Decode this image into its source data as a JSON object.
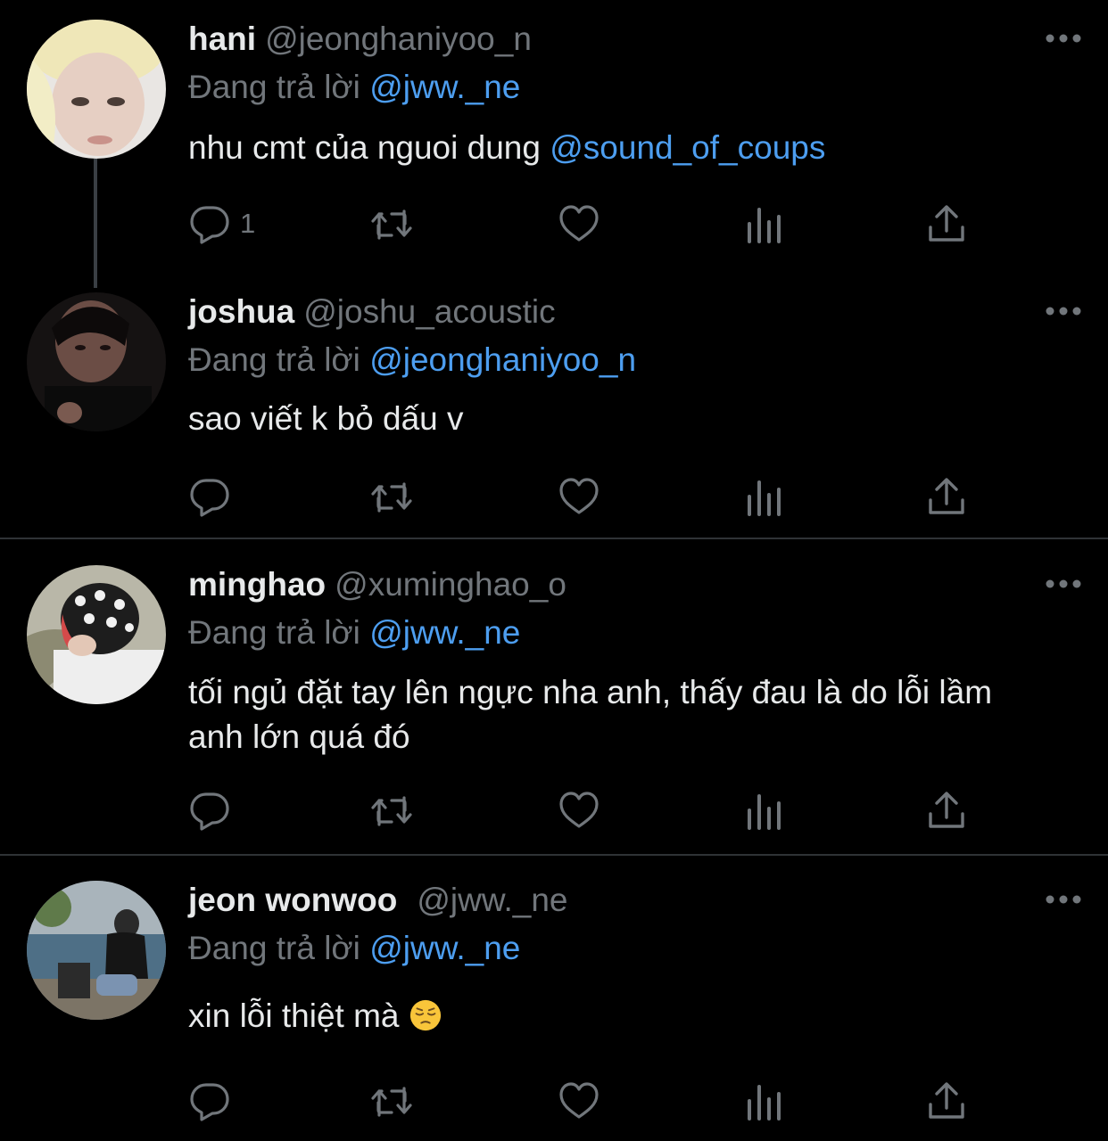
{
  "tweets": [
    {
      "name": "hani",
      "handle": "@jeonghaniyoo_n",
      "replying_prefix": "Đang trả lời",
      "replying_to": "@jww._ne",
      "text": "nhu cmt của nguoi dung ",
      "text_mention": "@sound_of_coups",
      "reply_count": "1"
    },
    {
      "name": "joshua",
      "handle": "@joshu_acoustic",
      "replying_prefix": "Đang trả lời",
      "replying_to": "@jeonghaniyoo_n",
      "text": "sao viết k bỏ dấu v"
    },
    {
      "name": "minghao",
      "handle": "@xuminghao_o",
      "replying_prefix": "Đang trả lời",
      "replying_to": "@jww._ne",
      "text": "tối ngủ đặt tay lên ngực nha anh, thấy đau là do lỗi lầm anh lớn quá đó"
    },
    {
      "name": "jeon wonwoo",
      "handle": "@jww._ne",
      "replying_prefix": "Đang trả lời",
      "replying_to": "@jww._ne",
      "text": "xin lỗi thiệt mà ",
      "emoji": "pensive-face"
    }
  ],
  "icons": {
    "reply": "reply-icon",
    "retweet": "retweet-icon",
    "like": "like-icon",
    "views": "views-icon",
    "share": "share-icon",
    "more": "more-icon"
  },
  "colors": {
    "background": "#000000",
    "text": "#e7e9ea",
    "secondary": "#71767b",
    "mention": "#4d9ef0",
    "divider": "#2f3336"
  }
}
